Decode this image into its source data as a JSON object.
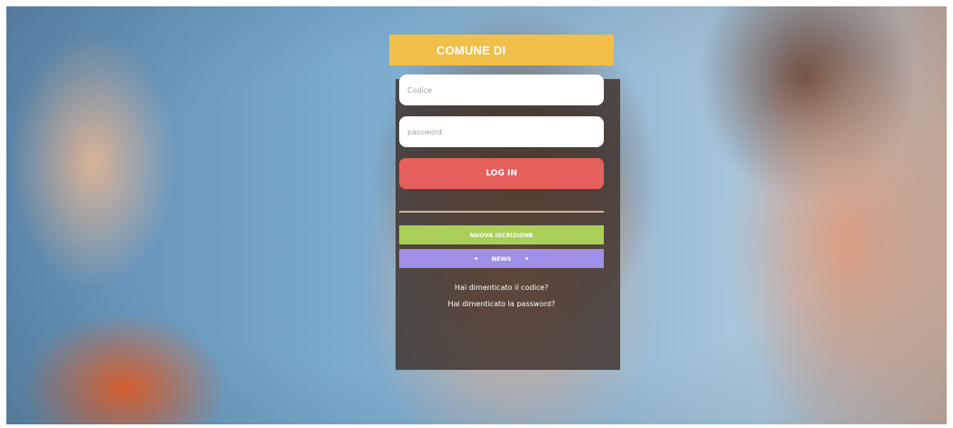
{
  "header": {
    "title": "COMUNE DI"
  },
  "form": {
    "code_placeholder": "Codice",
    "password_placeholder": "password",
    "login_label": "LOG IN"
  },
  "actions": {
    "registration_label": "NUOVA ISCRIZIONE",
    "news_label": "NEWS",
    "news_icon": "star-icon"
  },
  "links": {
    "forgot_code": "Hai dimenticato il codice?",
    "forgot_password": "Hai dimenticato la password?"
  },
  "colors": {
    "header": "#f2bf4a",
    "login": "#e5605c",
    "registration": "#a9cf58",
    "news": "#a08fe6"
  }
}
